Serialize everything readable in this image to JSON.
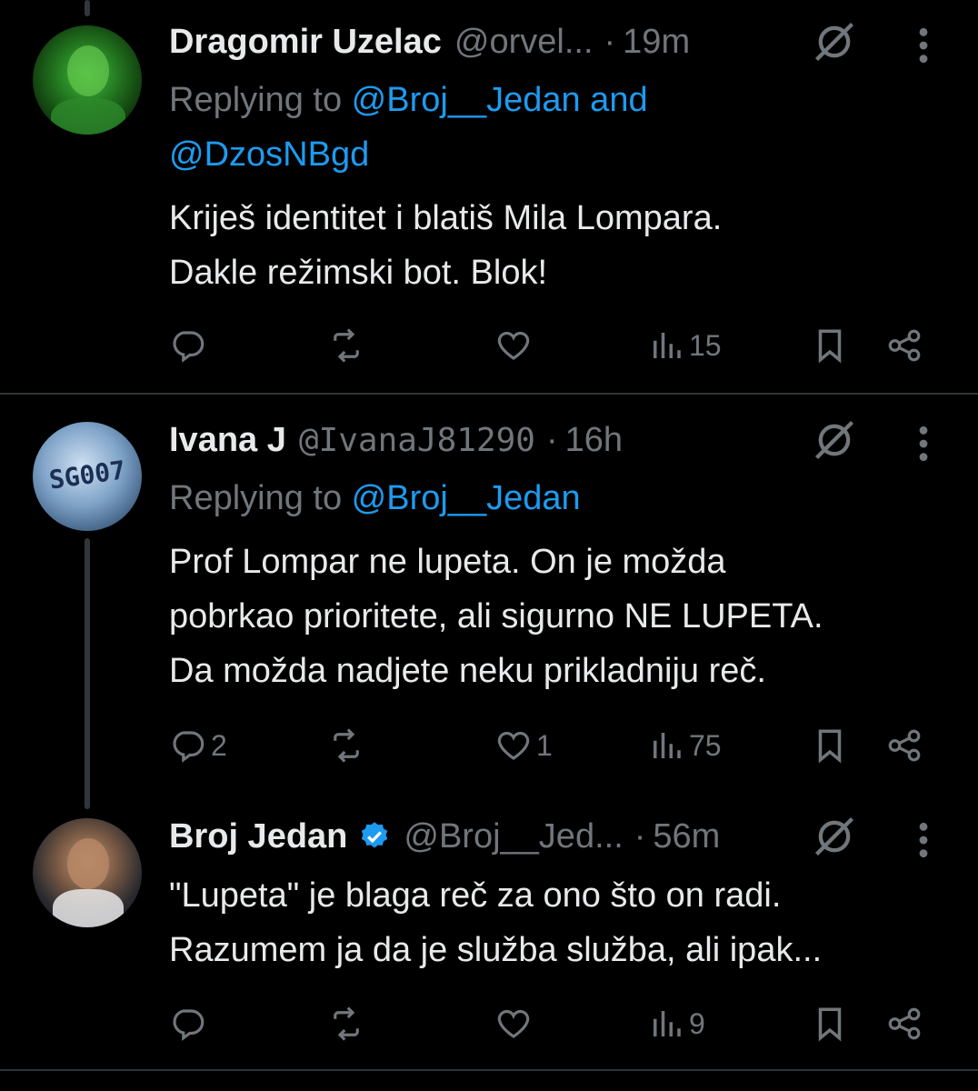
{
  "tweets": [
    {
      "name": "Dragomir Uzelac",
      "handle": "@orvel...",
      "separator": "·",
      "time": "19m",
      "replying_prefix": "Replying to ",
      "replying_users": "@Broj__Jedan and",
      "replying_users_2": "@DzosNBgd",
      "text_lines": [
        "Kriješ identitet i blatiš Mila Lompara.",
        "Dakle režimski bot. Blok!"
      ],
      "replies": "",
      "reposts": "",
      "likes": "",
      "views": "15"
    },
    {
      "name": "Ivana J",
      "handle": "@IvanaJ81290",
      "separator": "·",
      "time": "16h",
      "avatar_text": "SG007",
      "replying_prefix": "Replying to ",
      "replying_users": "@Broj__Jedan",
      "text_lines": [
        "Prof Lompar ne lupeta. On je možda",
        "pobrkao prioritete, ali sigurno NE LUPETA.",
        "Da možda nadjete neku prikladniju reč."
      ],
      "replies": "2",
      "reposts": "",
      "likes": "1",
      "views": "75"
    },
    {
      "name": "Broj Jedan",
      "handle": "@Broj__Jed...",
      "separator": "·",
      "time": "56m",
      "verified": true,
      "text_lines": [
        "\"Lupeta\" je blaga reč za ono što on radi.",
        "Razumem ja da je služba služba, ali ipak..."
      ],
      "replies": "",
      "reposts": "",
      "likes": "",
      "views": "9"
    }
  ],
  "icons": [
    "reply-icon",
    "repost-icon",
    "like-icon",
    "views-icon",
    "bookmark-icon",
    "share-icon",
    "grok-icon",
    "more-icon",
    "verified-badge-icon"
  ],
  "colors": {
    "background": "#000000",
    "text": "#e7e9ea",
    "muted": "#71767b",
    "link": "#1d9bf0",
    "divider": "#2f3336"
  }
}
